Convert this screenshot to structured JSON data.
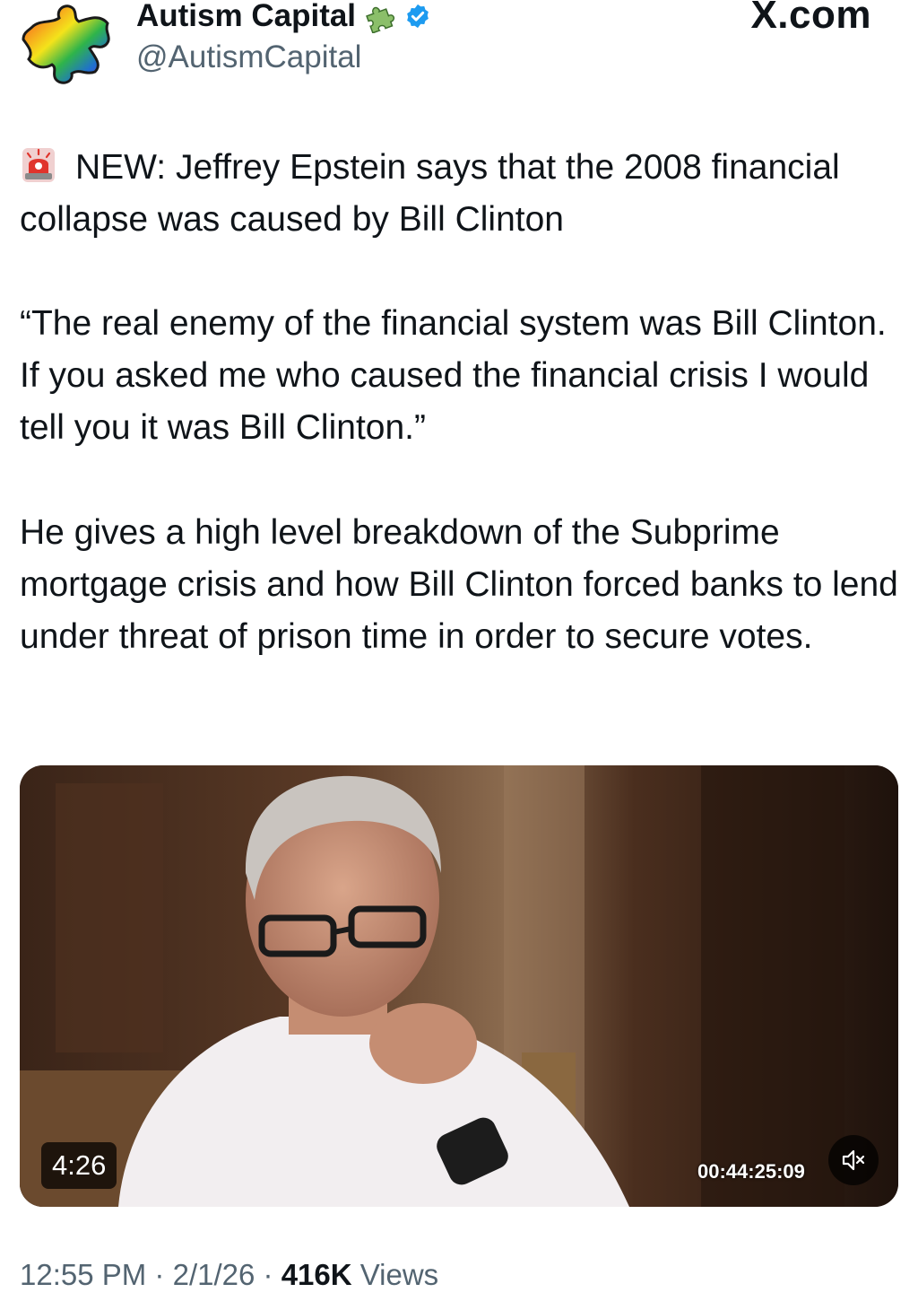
{
  "author": {
    "display_name": "Autism Capital",
    "handle": "@AutismCapital",
    "avatar_icon": "rainbow-puzzle-piece-icon",
    "name_badge_icon": "puzzle-piece-icon",
    "verified_icon": "verified-badge-icon",
    "verified_color": "#1d9bf0"
  },
  "site_label": "X.com",
  "tweet": {
    "alert_icon": "police-siren-icon",
    "paragraph_1": "NEW: Jeffrey Epstein says that the 2008 financial collapse was caused by Bill Clinton",
    "paragraph_2": "“The real enemy of the financial system was Bill Clinton. If you asked me who caused the financial crisis I would tell you it was Bill Clinton.”",
    "paragraph_3": "He gives a high level breakdown of the Subprime mortgage crisis and how Bill Clinton forced banks to lend under threat of prison time in order to secure votes."
  },
  "video": {
    "duration": "4:26",
    "timecode": "00:44:25:09",
    "mute_icon": "speaker-muted-icon"
  },
  "meta": {
    "time": "12:55 PM",
    "separator": "·",
    "date": "2/1/26",
    "views_count": "416K",
    "views_label": "Views"
  },
  "colors": {
    "text_primary": "#0f1419",
    "text_secondary": "#536471",
    "verified_blue": "#1d9bf0"
  }
}
